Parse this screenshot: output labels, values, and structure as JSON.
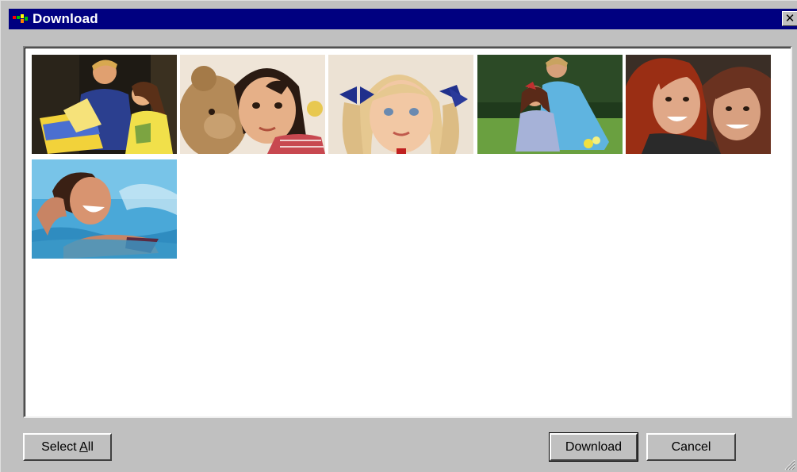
{
  "window": {
    "title": "Download"
  },
  "gallery": {
    "photos": [
      {
        "subject": "couple-shopping"
      },
      {
        "subject": "girl-with-teddy-bear"
      },
      {
        "subject": "girl-with-pigtails"
      },
      {
        "subject": "couple-outdoors"
      },
      {
        "subject": "two-women-smiling"
      },
      {
        "subject": "woman-swimming"
      }
    ]
  },
  "buttons": {
    "select_all_prefix": "Select ",
    "select_all_accel": "A",
    "select_all_suffix": "ll",
    "download": "Download",
    "cancel": "Cancel"
  },
  "colors": {
    "titlebar": "#000080",
    "dialog": "#c0c0c0",
    "canvas": "#ffffff"
  }
}
